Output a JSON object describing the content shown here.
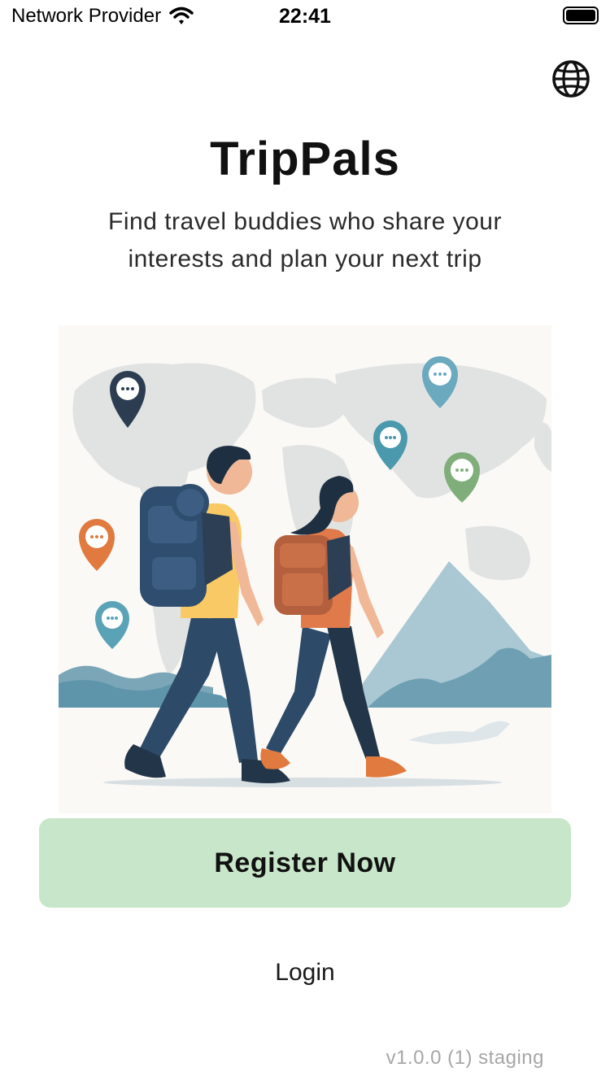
{
  "status_bar": {
    "carrier": "Network Provider",
    "time": "22:41"
  },
  "header": {
    "language_icon": "globe-icon"
  },
  "main": {
    "title": "TripPals",
    "subtitle": "Find travel buddies who share your interests and plan your next trip",
    "illustration": "travelers-world-map-illustration"
  },
  "actions": {
    "register_label": "Register Now",
    "login_label": "Login"
  },
  "footer": {
    "version": "v1.0.0 (1) staging"
  },
  "colors": {
    "register_button_bg": "#c8e6c9",
    "version_text": "#a6a6a6",
    "illustration_bg": "#fbf9f6"
  }
}
